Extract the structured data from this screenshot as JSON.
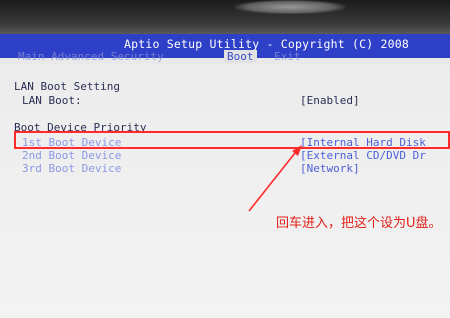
{
  "header": {
    "title": "Aptio Setup Utility - Copyright (C) 2008"
  },
  "tabs": [
    {
      "label": "Main  Advanced  Security"
    },
    {
      "label": "Boot"
    },
    {
      "label": "Exit"
    }
  ],
  "lan_boot": {
    "section_title": "LAN Boot Setting",
    "label": "LAN Boot:",
    "value": "[Enabled]"
  },
  "boot_priority": {
    "section_title": "Boot Device Priority",
    "items": [
      {
        "label": "1st Boot Device",
        "value": "[Internal Hard Disk"
      },
      {
        "label": "2nd Boot Device",
        "value": "[External CD/DVD Dr"
      },
      {
        "label": "3rd Boot Device",
        "value": "[Network]"
      }
    ]
  },
  "annotation": {
    "text": "回车进入，把这个设为U盘。"
  },
  "colors": {
    "header_bg": "#2f40c8",
    "annotation": "#e0201a",
    "highlight": "#ff2b2b"
  }
}
